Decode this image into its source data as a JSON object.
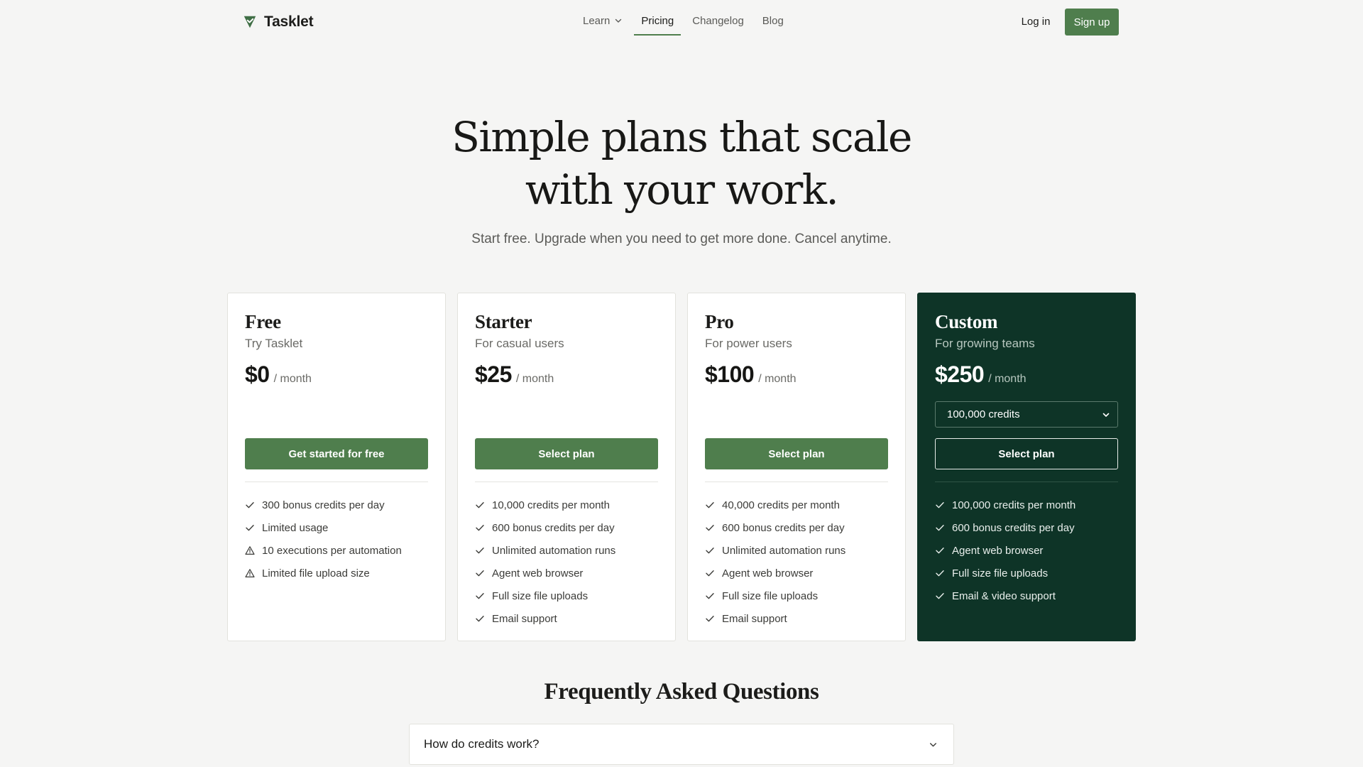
{
  "header": {
    "brand": "Tasklet",
    "nav": [
      {
        "label": "Learn"
      },
      {
        "label": "Pricing"
      },
      {
        "label": "Changelog"
      },
      {
        "label": "Blog"
      }
    ],
    "login_label": "Log in",
    "signup_label": "Sign up"
  },
  "hero": {
    "title_line1": "Simple plans that scale",
    "title_line2": "with your work.",
    "subtitle": "Start free. Upgrade when you need to get more done. Cancel anytime."
  },
  "plans": [
    {
      "name": "Free",
      "tagline": "Try Tasklet",
      "price": "$0",
      "period": "/ month",
      "button": "Get started for free",
      "features": [
        {
          "text": "300 bonus credits per day",
          "icon": "check-icon"
        },
        {
          "text": "Limited usage",
          "icon": "check-icon"
        },
        {
          "text": "10 executions per automation",
          "icon": "warning-icon"
        },
        {
          "text": "Limited file upload size",
          "icon": "warning-icon"
        }
      ]
    },
    {
      "name": "Starter",
      "tagline": "For casual users",
      "price": "$25",
      "period": "/ month",
      "button": "Select plan",
      "features": [
        {
          "text": "10,000 credits per month",
          "icon": "check-icon"
        },
        {
          "text": "600 bonus credits per day",
          "icon": "check-icon"
        },
        {
          "text": "Unlimited automation runs",
          "icon": "check-icon"
        },
        {
          "text": "Agent web browser",
          "icon": "check-icon"
        },
        {
          "text": "Full size file uploads",
          "icon": "check-icon"
        },
        {
          "text": "Email support",
          "icon": "check-icon"
        }
      ]
    },
    {
      "name": "Pro",
      "tagline": "For power users",
      "price": "$100",
      "period": "/ month",
      "button": "Select plan",
      "features": [
        {
          "text": "40,000 credits per month",
          "icon": "check-icon"
        },
        {
          "text": "600 bonus credits per day",
          "icon": "check-icon"
        },
        {
          "text": "Unlimited automation runs",
          "icon": "check-icon"
        },
        {
          "text": "Agent web browser",
          "icon": "check-icon"
        },
        {
          "text": "Full size file uploads",
          "icon": "check-icon"
        },
        {
          "text": "Email support",
          "icon": "check-icon"
        }
      ]
    },
    {
      "name": "Custom",
      "tagline": "For growing teams",
      "price": "$250",
      "period": "/ month",
      "selector_value": "100,000 credits",
      "button": "Select plan",
      "features": [
        {
          "text": "100,000 credits per month",
          "icon": "check-icon"
        },
        {
          "text": "600 bonus credits per day",
          "icon": "check-icon"
        },
        {
          "text": "Agent web browser",
          "icon": "check-icon"
        },
        {
          "text": "Full size file uploads",
          "icon": "check-icon"
        },
        {
          "text": "Email & video support",
          "icon": "check-icon"
        }
      ]
    }
  ],
  "faq": {
    "title": "Frequently Asked Questions",
    "items": [
      {
        "question": "How do credits work?"
      }
    ]
  },
  "colors": {
    "accent": "#4f7e4d",
    "dark_card": "#0e3427",
    "background": "#f5f5f4"
  }
}
